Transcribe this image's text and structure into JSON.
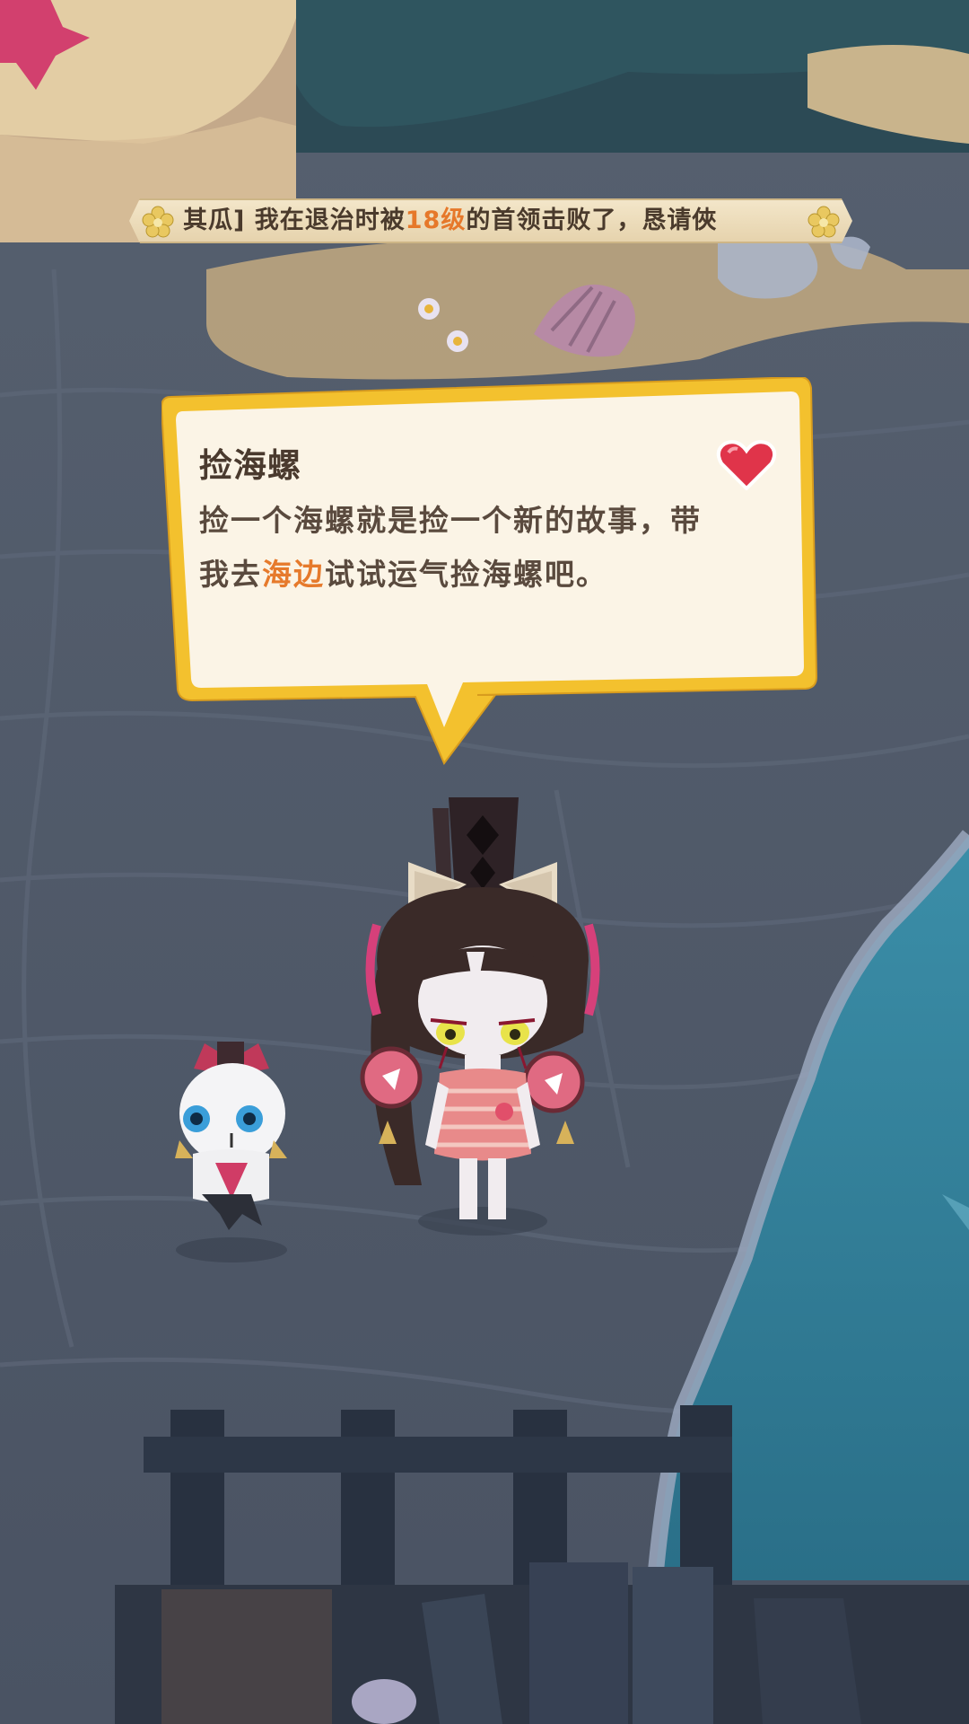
{
  "ticker": {
    "prefix": "其瓜] 我在退治时被",
    "highlight": "18级",
    "suffix": "的首领击败了，恳请俠",
    "highlight_color": "#e6782a"
  },
  "speech_bubble": {
    "title": "捡海螺",
    "body_line1": "捡一个海螺就是捡一个新的故事，带",
    "body_line2_prefix": "我去",
    "body_line2_highlight": "海边",
    "body_line2_suffix": "试试运气捡海螺吧。",
    "highlight_color": "#e67a2c",
    "icon": "heart-icon",
    "border_color": "#f1c23a",
    "fill_color": "#fbf4e6"
  },
  "scene": {
    "characters": [
      "shikigami-girl-character",
      "white-mask-companion"
    ],
    "colors": {
      "ground": "#525c6c",
      "water": "#2f7f99",
      "sand": "#bca57e"
    }
  }
}
